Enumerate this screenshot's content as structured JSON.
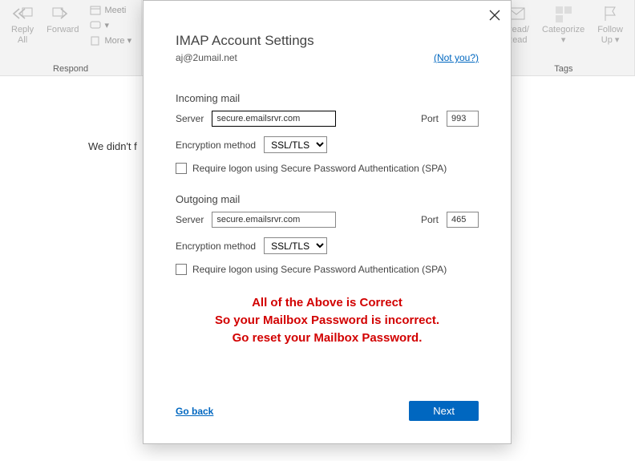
{
  "ribbon": {
    "respond": {
      "reply_all": "Reply\nAll",
      "forward": "Forward",
      "meeting": "Meeti",
      "im_dd": "▾",
      "more": "More ▾",
      "group_label": "Respond"
    },
    "tags": {
      "unread": "nread/\nRead",
      "categorize": "Categorize\n▾",
      "followup": "Follow\nUp ▾",
      "group_label": "Tags"
    }
  },
  "bg_message": "We didn't f",
  "dialog": {
    "title": "IMAP Account Settings",
    "email": "aj@2umail.net",
    "not_you": "(Not you?)",
    "incoming": {
      "section": "Incoming mail",
      "server_label": "Server",
      "server_value": "secure.emailsrvr.com",
      "port_label": "Port",
      "port_value": "993",
      "encryption_label": "Encryption method",
      "encryption_value": "SSL/TLS",
      "spa_label": "Require logon using Secure Password Authentication (SPA)"
    },
    "outgoing": {
      "section": "Outgoing mail",
      "server_label": "Server",
      "server_value": "secure.emailsrvr.com",
      "port_label": "Port",
      "port_value": "465",
      "encryption_label": "Encryption method",
      "encryption_value": "SSL/TLS",
      "spa_label": "Require logon using Secure Password Authentication (SPA)"
    },
    "red_line1": "All of the Above is Correct",
    "red_line2": "So your Mailbox Password is incorrect.",
    "red_line3": "Go reset your Mailbox Password.",
    "go_back": "Go back",
    "next": "Next"
  }
}
